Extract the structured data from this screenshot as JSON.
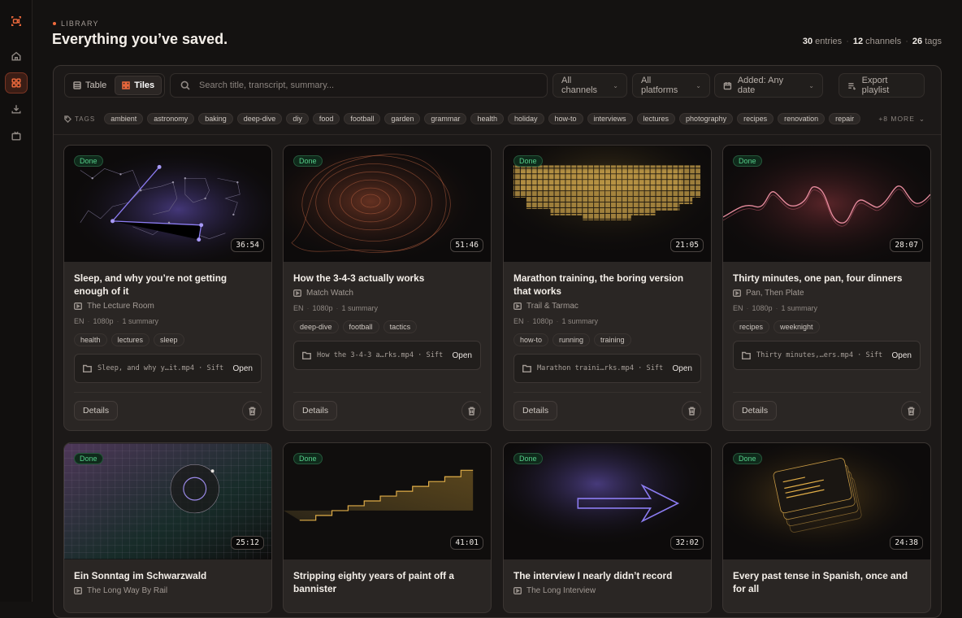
{
  "header": {
    "kicker": "LIBRARY",
    "title": "Everything you’ve saved.",
    "stats": {
      "entries_num": "30",
      "entries_label": "entries",
      "channels_num": "12",
      "channels_label": "channels",
      "tags_num": "26",
      "tags_label": "tags"
    }
  },
  "nav": {
    "items": [
      "logo-icon",
      "home-icon",
      "library-icon",
      "download-icon",
      "tv-icon"
    ],
    "active": "library-icon"
  },
  "toolbar": {
    "view_table": "Table",
    "view_tiles": "Tiles",
    "active_view": "Tiles",
    "search_placeholder": "Search title, transcript, summary...",
    "channels": "All channels",
    "platforms": "All platforms",
    "date": "Added: Any date",
    "export": "Export playlist"
  },
  "tags": {
    "label": "TAGS",
    "items": [
      "ambient",
      "astronomy",
      "baking",
      "deep-dive",
      "diy",
      "food",
      "football",
      "garden",
      "grammar",
      "health",
      "holiday",
      "how-to",
      "interviews",
      "lectures",
      "photography",
      "recipes",
      "renovation",
      "repair"
    ],
    "more": "+8 MORE"
  },
  "colors": {
    "accent": "#f26b3d",
    "done": "#55d08a",
    "background": "#141211"
  },
  "cards": [
    {
      "status": "Done",
      "duration": "36:54",
      "title": "Sleep, and why you’re not getting enough of it",
      "channel": "The Lecture Room",
      "lang": "EN",
      "res": "1080p",
      "summary": "1 summary",
      "tags": [
        "health",
        "lectures",
        "sleep"
      ],
      "file": "Sleep, and why y…it.mp4 · Sift",
      "open": "Open",
      "details": "Details"
    },
    {
      "status": "Done",
      "duration": "51:46",
      "title": "How the 3-4-3 actually works",
      "channel": "Match Watch",
      "lang": "EN",
      "res": "1080p",
      "summary": "1 summary",
      "tags": [
        "deep-dive",
        "football",
        "tactics"
      ],
      "file": "How the 3-4-3 a…rks.mp4 · Sift",
      "open": "Open",
      "details": "Details"
    },
    {
      "status": "Done",
      "duration": "21:05",
      "title": "Marathon training, the boring version that works",
      "channel": "Trail & Tarmac",
      "lang": "EN",
      "res": "1080p",
      "summary": "1 summary",
      "tags": [
        "how-to",
        "running",
        "training"
      ],
      "file": "Marathon traini…rks.mp4 · Sift",
      "open": "Open",
      "details": "Details"
    },
    {
      "status": "Done",
      "duration": "28:07",
      "title": "Thirty minutes, one pan, four dinners",
      "channel": "Pan, Then Plate",
      "lang": "EN",
      "res": "1080p",
      "summary": "1 summary",
      "tags": [
        "recipes",
        "weeknight"
      ],
      "file": "Thirty minutes,…ers.mp4 · Sift",
      "open": "Open",
      "details": "Details"
    },
    {
      "status": "Done",
      "duration": "25:12",
      "title": "Ein Sonntag im Schwarzwald",
      "channel": "The Long Way By Rail"
    },
    {
      "status": "Done",
      "duration": "41:01",
      "title": "Stripping eighty years of paint off a bannister",
      "channel": ""
    },
    {
      "status": "Done",
      "duration": "32:02",
      "title": "The interview I nearly didn’t record",
      "channel": "The Long Interview"
    },
    {
      "status": "Done",
      "duration": "24:38",
      "title": "Every past tense in Spanish, once and for all",
      "channel": ""
    }
  ]
}
